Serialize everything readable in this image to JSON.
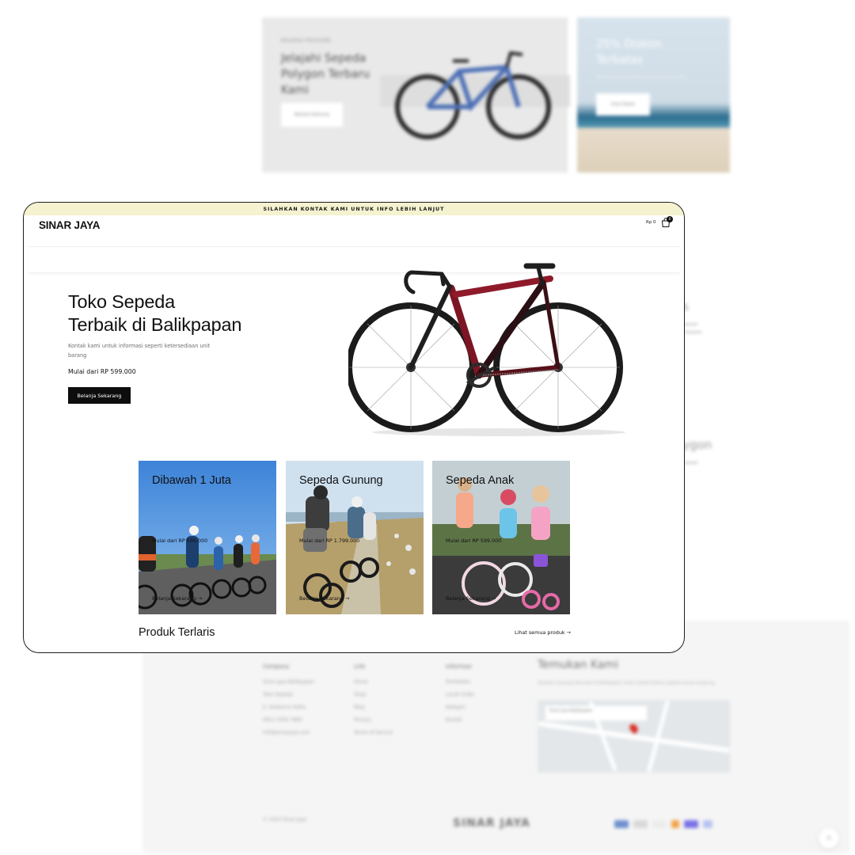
{
  "background": {
    "promo_left": {
      "eyebrow": "KOLEKSI POLYGON",
      "headline": "Jelajahi Sepeda Polygon Terbaru Kami",
      "button": "Belanja Sekarang"
    },
    "promo_right": {
      "headline": "25% Diskon Terbatas",
      "sub": "Nikmati diskon terbatas untuk sepeda pilihan",
      "button": "Lihat Diskon"
    },
    "side_heading_1": "ls",
    "side_heading_2": "lygon",
    "footer": {
      "col_company": {
        "title": "Company",
        "lines": [
          "Sinar Jaya Balikpapan",
          "Toko Sepeda",
          "Jl. Soekarno Hatta",
          "0812 3456 7890",
          "info@sinarjaya.com"
        ]
      },
      "col_link": {
        "title": "Link",
        "lines": [
          "Home",
          "Shop",
          "Blog",
          "Privacy",
          "Terms of Service"
        ]
      },
      "col_info": {
        "title": "Informasi",
        "lines": [
          "Pembelian",
          "Lacak Order",
          "Kategori",
          "Kontak"
        ]
      },
      "find_title": "Temukan Kami",
      "find_text": "Silahkan kunjungi toko kami di Balikpapan untuk melihat koleksi sepeda secara langsung.",
      "map_label": "Sinar Jaya Balikpapan",
      "copyright": "© 2024 Sinar Jaya",
      "logo": "SINAR JAYA"
    }
  },
  "window": {
    "announcement": "SILAHKAN KONTAK KAMI UNTUK INFO LEBIH LANJUT",
    "logo": "SINAR JAYA",
    "cart": {
      "price": "Rp 0",
      "count": "0",
      "icon": "cart-icon"
    },
    "hero": {
      "title_line1": "Toko Sepeda",
      "title_line2": "Terbaik di Balikpapan",
      "subtitle": "Kontak kami untuk informasi seperti ketersediaan unit barang",
      "price": "Mulai dari RP 599.000",
      "button": "Belanja Sekarang"
    },
    "categories": [
      {
        "title": "Dibawah 1 Juta",
        "price": "Mulai dari RP 599.000",
        "link": "Belanja Sekarang →"
      },
      {
        "title": "Sepeda Gunung",
        "price": "Mulai dari RP 1.799.000",
        "link": "Belanja Sekarang →"
      },
      {
        "title": "Sepeda Anak",
        "price": "Mulai dari RP 599.000",
        "link": "Belanja Sekarang →"
      }
    ],
    "best_seller": {
      "title": "Produk Terlaris",
      "link": "Lihat semua produk →"
    }
  },
  "colors": {
    "announcement_bg": "#f5f2cf",
    "button_bg": "#0d0d0d",
    "bike_red": "#8e1a2a",
    "bg_bike_blue": "#4d6fb5"
  }
}
